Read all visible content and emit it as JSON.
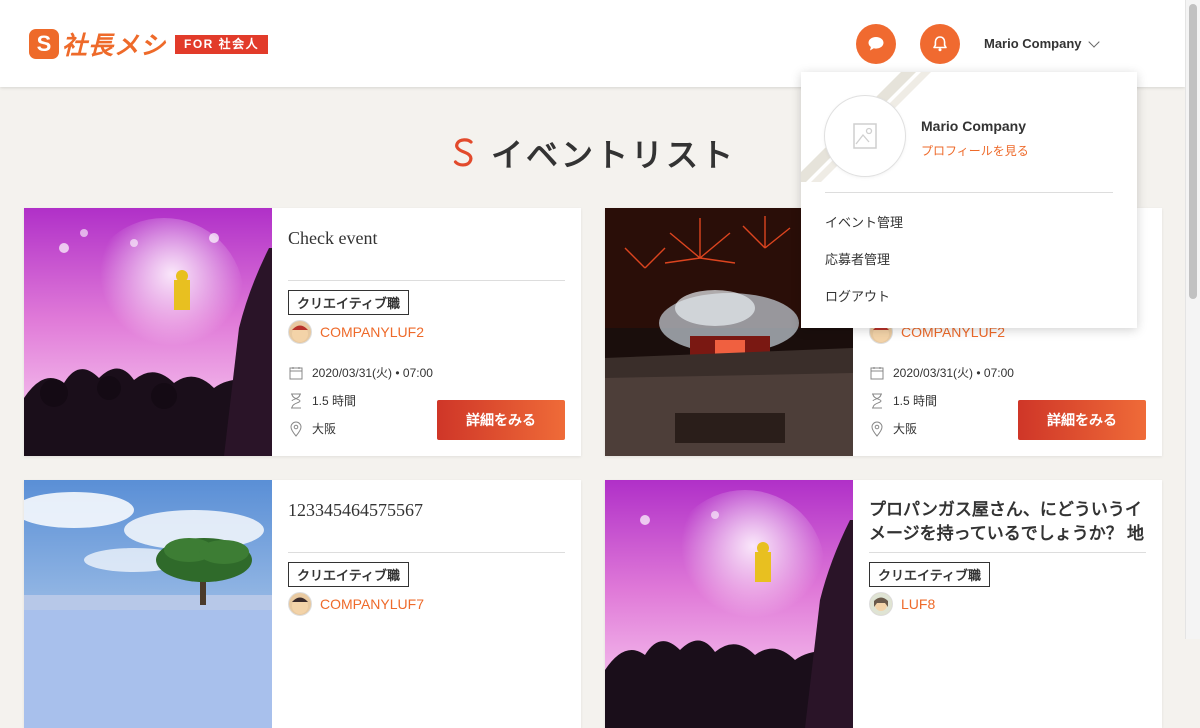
{
  "header": {
    "logo_mark": "S",
    "logo_text": "社長メシ",
    "logo_badge": "FOR 社会人",
    "user_name": "Mario Company"
  },
  "page_title": "イベントリスト",
  "colors": {
    "accent": "#ee6a2a",
    "button_start": "#cf3628",
    "button_end": "#ef6b38",
    "background": "#f4f2ee"
  },
  "dropdown": {
    "name": "Mario Company",
    "profile_link": "プロフィールを見る",
    "items": [
      "イベント管理",
      "応募者管理",
      "ログアウト"
    ]
  },
  "cards": [
    {
      "title": "Check event",
      "tag": "クリエイティブ職",
      "company": "COMPANYLUF2",
      "datetime": "2020/03/31(火) • 07:00",
      "duration": "1.5 時間",
      "location": "大阪",
      "button": "詳細をみる",
      "image": "concert"
    },
    {
      "title": "",
      "tag": "",
      "company": "COMPANYLUF2",
      "datetime": "2020/03/31(火) • 07:00",
      "duration": "1.5 時間",
      "location": "大阪",
      "button": "詳細をみる",
      "image": "fireworks-stadium"
    },
    {
      "title": "123345464575567",
      "tag": "クリエイティブ職",
      "company": "COMPANYLUF7",
      "image": "tree-flowers"
    },
    {
      "title": "プロパンガス屋さん、にどういうイメージを持っているでしょうか？ 地味 …",
      "tag": "クリエイティブ職",
      "company": "LUF8",
      "image": "concert"
    }
  ]
}
